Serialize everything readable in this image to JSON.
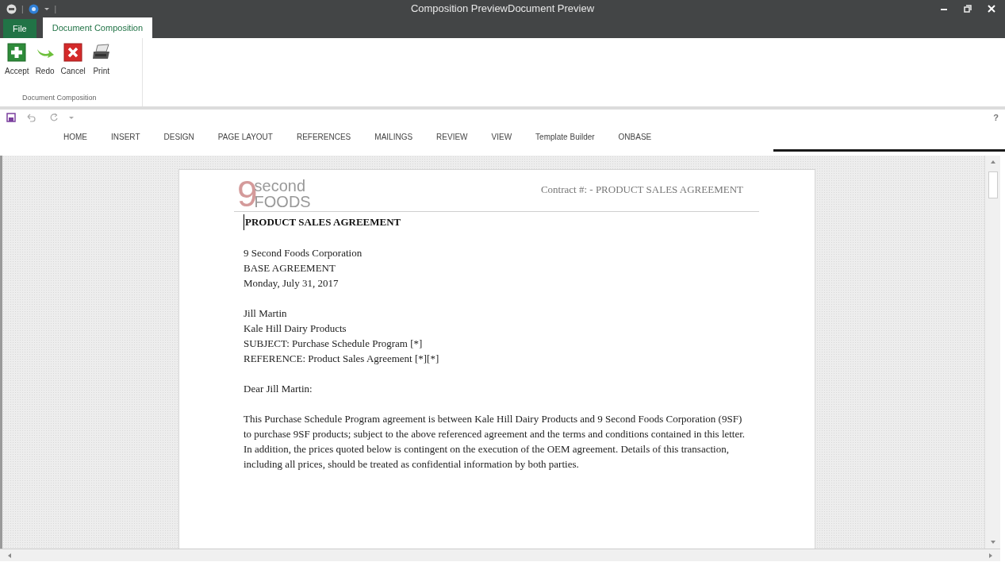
{
  "window": {
    "title": "Composition PreviewDocument Preview"
  },
  "quick_access": {
    "separator_1": "|",
    "separator_2": "|"
  },
  "ribbon_tabs": [
    {
      "label": "File",
      "kind": "file",
      "selected": false
    },
    {
      "label": "Document Composition",
      "kind": "tab",
      "selected": true
    }
  ],
  "ribbon_buttons": [
    {
      "label": "Accept",
      "kind": "accept"
    },
    {
      "label": "Redo",
      "kind": "redo"
    },
    {
      "label": "Cancel",
      "kind": "cancel"
    },
    {
      "label": "Print",
      "kind": "print"
    }
  ],
  "ribbon_group": "Document Composition",
  "editor": {
    "help": "?",
    "tabs": [
      {
        "label": "HOME"
      },
      {
        "label": "INSERT"
      },
      {
        "label": "DESIGN"
      },
      {
        "label": "PAGE LAYOUT"
      },
      {
        "label": "REFERENCES"
      },
      {
        "label": "MAILINGS"
      },
      {
        "label": "REVIEW"
      },
      {
        "label": "VIEW"
      },
      {
        "label": "Template Builder"
      },
      {
        "label": "ONBASE"
      }
    ]
  },
  "document": {
    "logo": {
      "digit": "9",
      "line_1": "second",
      "line_2": "FOODS"
    },
    "header": "Contract #:   - PRODUCT SALES AGREEMENT",
    "heading": "PRODUCT SALES AGREEMENT",
    "blocks": [
      [
        "9 Second Foods Corporation",
        "BASE AGREEMENT",
        "Monday, July 31, 2017"
      ],
      [
        "Jill Martin",
        "Kale Hill Dairy Products",
        "SUBJECT: Purchase Schedule Program [*]",
        "REFERENCE: Product Sales Agreement [*][*]"
      ],
      [
        "Dear Jill Martin:"
      ],
      [
        "This Purchase Schedule Program agreement is between Kale Hill Dairy Products and 9 Second Foods Corporation (9SF) to purchase 9SF products; subject to the above referenced agreement and the terms and conditions contained in this letter. In addition, the prices quoted below is contingent on the execution of the OEM agreement. Details of this transaction, including all prices, should be treated as confidential information by both parties."
      ]
    ]
  }
}
